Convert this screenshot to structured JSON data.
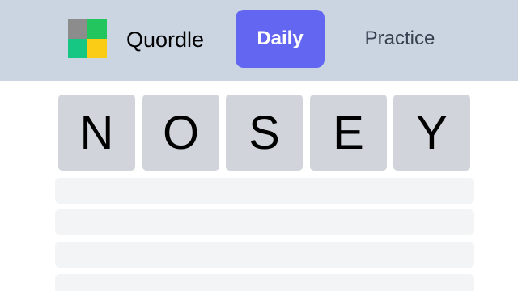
{
  "header": {
    "brand": "Quordle",
    "tabs": {
      "daily": "Daily",
      "practice": "Practice"
    },
    "logo_colors": [
      "#8c8c8c",
      "#22c55e",
      "#22c55e",
      "#facc15"
    ]
  },
  "board": {
    "current_word": [
      "N",
      "O",
      "S",
      "E",
      "Y"
    ],
    "empty_rows": 4
  },
  "colors": {
    "header_bg": "#cbd5e1",
    "accent": "#6366f1",
    "tile_bg": "#d1d5db",
    "empty_row_bg": "#f3f4f6"
  }
}
